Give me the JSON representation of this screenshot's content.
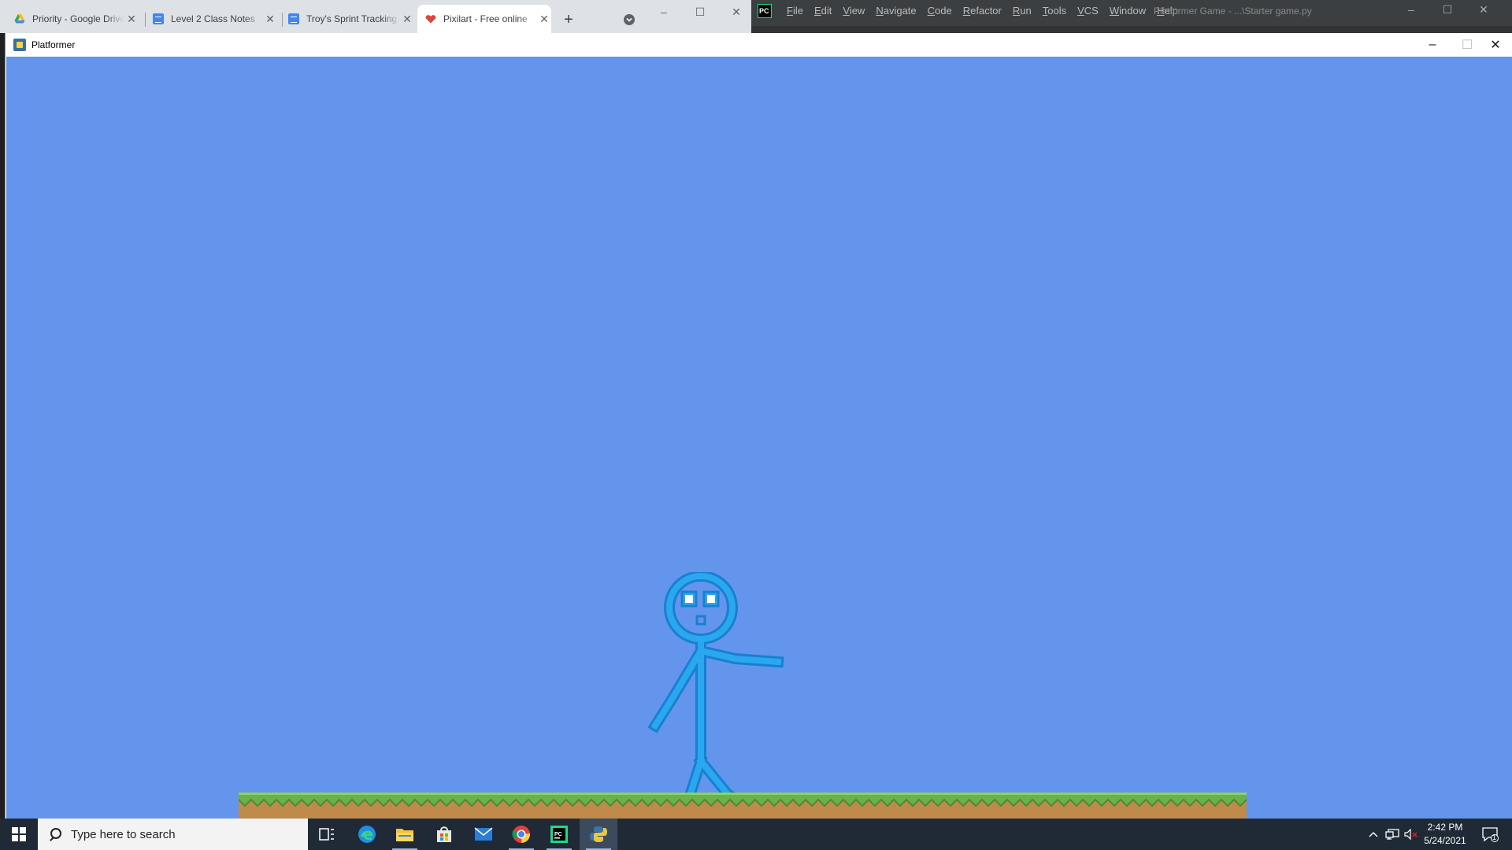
{
  "browser": {
    "tabs": [
      {
        "title": "Priority - Google Drive",
        "icon": "google-drive-icon"
      },
      {
        "title": "Level 2 Class Notes",
        "icon": "google-docs-icon"
      },
      {
        "title": "Troy's Sprint Tracking",
        "icon": "google-docs-icon"
      },
      {
        "title": "Pixilart - Free online",
        "icon": "pixilart-heart-icon"
      }
    ],
    "new_tab": "+",
    "close_glyph": "✕"
  },
  "pycharm": {
    "logo": "PC",
    "menu": [
      "File",
      "Edit",
      "View",
      "Navigate",
      "Code",
      "Refactor",
      "Run",
      "Tools",
      "VCS",
      "Window",
      "Help"
    ],
    "title": "Platformer Game - ...\\Starter game.py"
  },
  "game_window": {
    "title": "Platformer",
    "colors": {
      "sky": "#6495ed",
      "grass": "#6ab04c",
      "dirt": "#c08a4c",
      "character": "#29a8f0",
      "outline": "#1a7fd0",
      "eyes": "#ffffff"
    }
  },
  "taskbar": {
    "search_placeholder": "Type here to search",
    "apps": [
      "task-view-icon",
      "edge-icon",
      "file-explorer-icon",
      "store-icon",
      "mail-icon",
      "chrome-icon",
      "pycharm-icon",
      "python-icon"
    ],
    "time": "2:42 PM",
    "date": "5/24/2021",
    "notification_count": "1"
  }
}
